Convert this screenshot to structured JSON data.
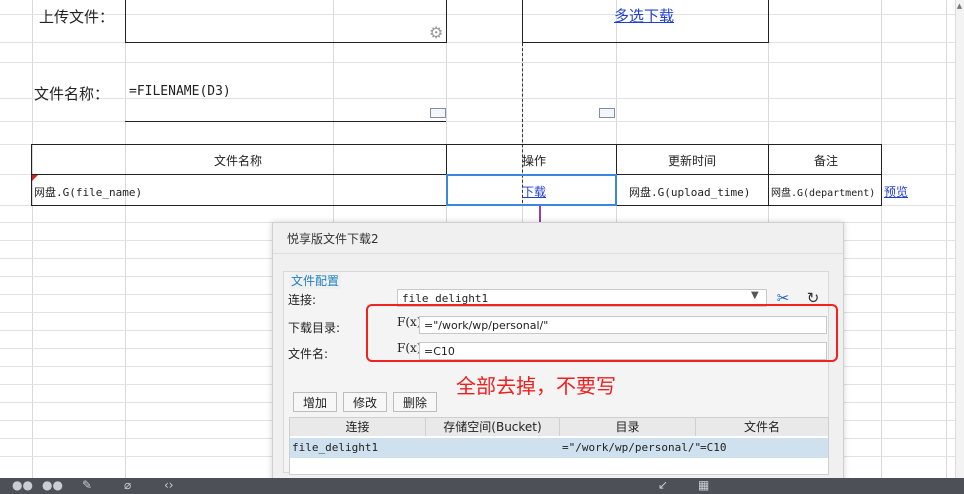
{
  "sheet": {
    "upload_label": "上传文件：",
    "multi_download_link": "多选下载",
    "filename_label": "文件名称：",
    "filename_formula": "=FILENAME(D3)",
    "headers": [
      "文件名称",
      "操作",
      "更新时间",
      "备注"
    ],
    "row": {
      "file_name": "网盘.G(file_name)",
      "download_link": "下载",
      "upload_time": "网盘.G(upload_time)",
      "department": "网盘.G(department)",
      "preview_link": "预览"
    }
  },
  "dialog": {
    "title": "悦享版文件下载2",
    "group_title": "文件配置",
    "connection_label": "连接:",
    "connection_value": "file_delight1",
    "dir_label": "下载目录:",
    "dir_value": "=\"/work/wp/personal/\"",
    "file_label": "文件名:",
    "file_value": "=C10",
    "fx_label": "F(x)",
    "buttons": {
      "add": "增加",
      "edit": "修改",
      "delete": "删除"
    },
    "table": {
      "headers": [
        "连接",
        "存储空间(Bucket)",
        "目录",
        "文件名"
      ],
      "rows": [
        {
          "connection": "file_delight1",
          "bucket": "",
          "dir": "=\"/work/wp/personal/\"",
          "file": "=C10"
        }
      ]
    }
  },
  "annotation": {
    "text": "全部去掉，不要写",
    "color": "#ee1f1f"
  },
  "colors": {
    "selection": "#3a86e0",
    "arrow": "#9a3ea8",
    "link": "#1f3fd0"
  }
}
